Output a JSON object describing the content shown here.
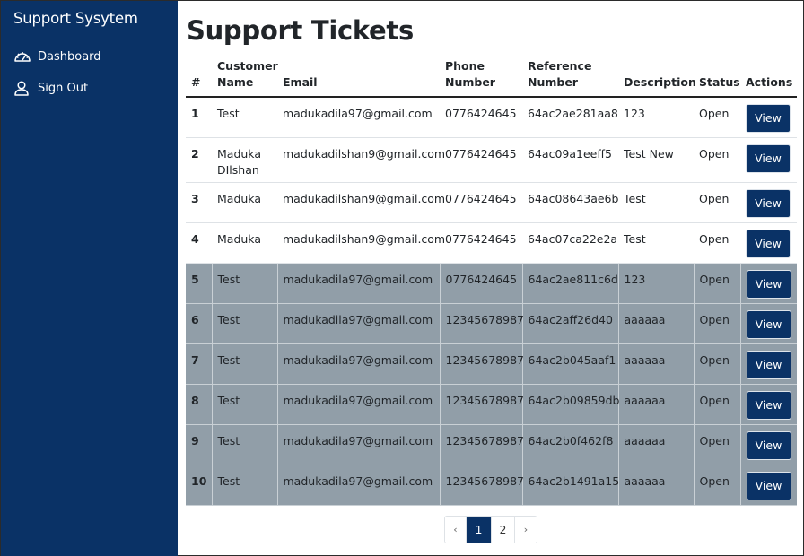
{
  "sidebar": {
    "brand": "Support Sysytem",
    "items": [
      {
        "label": "Dashboard",
        "icon": "speedometer-icon"
      },
      {
        "label": "Sign Out",
        "icon": "person-icon"
      }
    ]
  },
  "main": {
    "title": "Support Tickets",
    "columns": {
      "num": "#",
      "name": "Customer Name",
      "email": "Email",
      "phone": "Phone Number",
      "ref": "Reference Number",
      "desc": "Description",
      "status": "Status",
      "actions": "Actions"
    },
    "rows": [
      {
        "num": "1",
        "name": "Test",
        "email": "madukadila97@gmail.com",
        "phone": "0776424645",
        "ref": "64ac2ae281aa8",
        "desc": "123",
        "status": "Open",
        "action": "View"
      },
      {
        "num": "2",
        "name": "Maduka DIlshan",
        "email": "madukadilshan9@gmail.com",
        "phone": "0776424645",
        "ref": "64ac09a1eeff5",
        "desc": "Test New",
        "status": "Open",
        "action": "View"
      },
      {
        "num": "3",
        "name": "Maduka",
        "email": "madukadilshan9@gmail.com",
        "phone": "0776424645",
        "ref": "64ac08643ae6b",
        "desc": "Test",
        "status": "Open",
        "action": "View"
      },
      {
        "num": "4",
        "name": "Maduka",
        "email": "madukadilshan9@gmail.com",
        "phone": "0776424645",
        "ref": "64ac07ca22e2a",
        "desc": "Test",
        "status": "Open",
        "action": "View"
      },
      {
        "num": "5",
        "name": "Test",
        "email": "madukadila97@gmail.com",
        "phone": "0776424645",
        "ref": "64ac2ae811c6d",
        "desc": "123",
        "status": "Open",
        "action": "View"
      },
      {
        "num": "6",
        "name": "Test",
        "email": "madukadila97@gmail.com",
        "phone": "12345678987",
        "ref": "64ac2aff26d40",
        "desc": "aaaaaa",
        "status": "Open",
        "action": "View"
      },
      {
        "num": "7",
        "name": "Test",
        "email": "madukadila97@gmail.com",
        "phone": "12345678987",
        "ref": "64ac2b045aaf1",
        "desc": "aaaaaa",
        "status": "Open",
        "action": "View"
      },
      {
        "num": "8",
        "name": "Test",
        "email": "madukadila97@gmail.com",
        "phone": "12345678987",
        "ref": "64ac2b09859db",
        "desc": "aaaaaa",
        "status": "Open",
        "action": "View"
      },
      {
        "num": "9",
        "name": "Test",
        "email": "madukadila97@gmail.com",
        "phone": "12345678987",
        "ref": "64ac2b0f462f8",
        "desc": "aaaaaa",
        "status": "Open",
        "action": "View"
      },
      {
        "num": "10",
        "name": "Test",
        "email": "madukadila97@gmail.com",
        "phone": "12345678987",
        "ref": "64ac2b1491a15",
        "desc": "aaaaaa",
        "status": "Open",
        "action": "View"
      }
    ]
  },
  "pagination": {
    "prev": "‹",
    "pages": [
      "1",
      "2"
    ],
    "current": "1",
    "next": "›"
  },
  "colors": {
    "sidebar_bg": "#0a3266",
    "button_bg": "#0a3266",
    "highlight_row_bg": "#919ea8"
  }
}
